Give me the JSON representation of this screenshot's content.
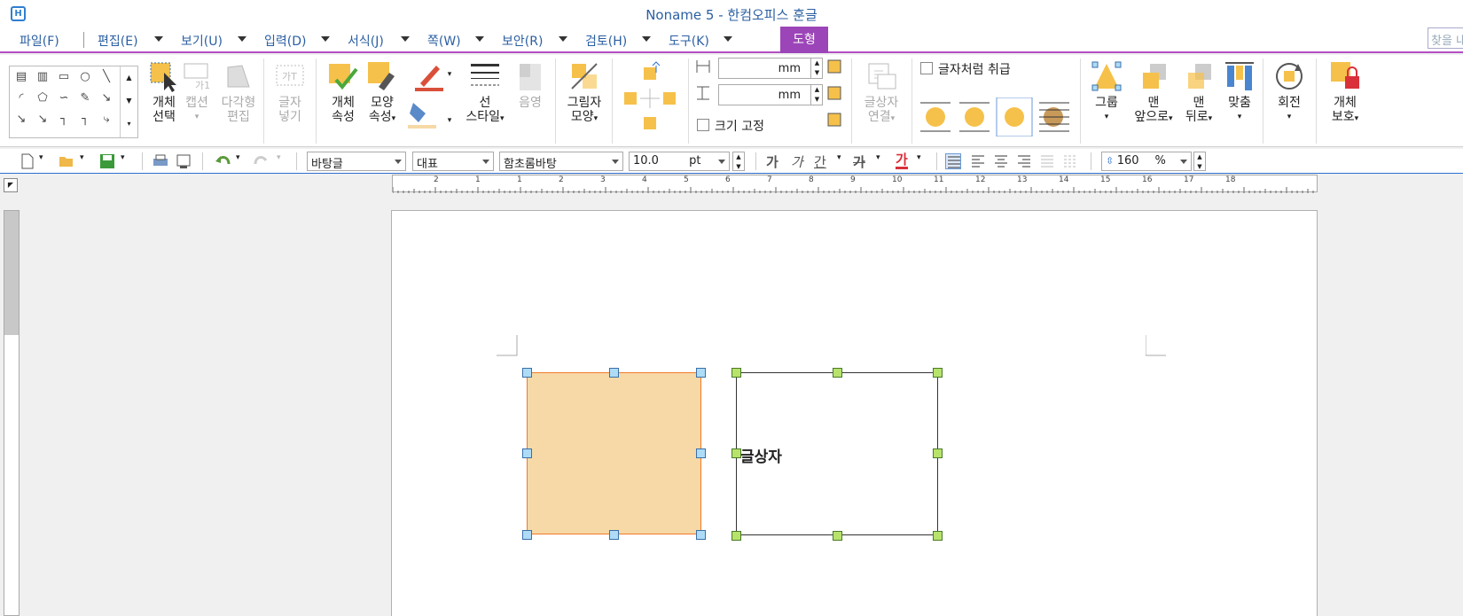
{
  "window": {
    "title": "Noname 5 - 한컴오피스 훈글"
  },
  "menu": {
    "items": [
      "파일(F)",
      "편집(E)",
      "보기(U)",
      "입력(D)",
      "서식(J)",
      "쪽(W)",
      "보안(R)",
      "검토(H)",
      "도구(K)"
    ],
    "active": "도형",
    "find_placeholder": "찾을 내"
  },
  "ribbon": {
    "select_object": {
      "line1": "개체",
      "line2": "선택"
    },
    "caption": {
      "line1": "캡션"
    },
    "polygon_edit": {
      "line1": "다각형",
      "line2": "편집"
    },
    "text_insert": {
      "line1": "글자",
      "line2": "넣기"
    },
    "object_props": {
      "line1": "개체",
      "line2": "속성"
    },
    "shape_props": {
      "line1": "모양",
      "line2": "속성"
    },
    "line_style": {
      "line1": "선",
      "line2": "스타일"
    },
    "shadow": {
      "line1": "음영"
    },
    "picture_shape": {
      "line1": "그림자",
      "line2": "모양"
    },
    "width_value": "mm",
    "height_value": "mm",
    "size_fixed": "크기 고정",
    "textbox_link": {
      "line1": "글상자",
      "line2": "연결"
    },
    "treat_as_char": "글자처럼 취급",
    "group": {
      "line1": "그룹"
    },
    "bring_front": {
      "line1": "맨",
      "line2": "앞으로"
    },
    "send_back": {
      "line1": "맨",
      "line2": "뒤로"
    },
    "align": {
      "line1": "맞춤"
    },
    "rotate": {
      "line1": "회전"
    },
    "protect": {
      "line1": "개체",
      "line2": "보호"
    }
  },
  "toolbar": {
    "style": "바탕글",
    "lang": "대표",
    "font": "함초롬바탕",
    "size": "10.0",
    "size_unit": "pt",
    "zoom": "160",
    "zoom_unit": "%",
    "bold": "가",
    "italic": "가",
    "underline": "간",
    "strike": "가",
    "color": "가"
  },
  "ruler": {
    "h_ticks": [
      "2",
      "1",
      "1",
      "2",
      "3",
      "4",
      "5",
      "6",
      "7",
      "8",
      "9",
      "10",
      "11",
      "12",
      "13",
      "14",
      "15",
      "16",
      "17",
      "18"
    ]
  },
  "document": {
    "textbox_text": "글상자"
  },
  "colors": {
    "accent": "#9c45b8",
    "shape_fill": "#f6d9a6",
    "shape_border": "#f07a2a",
    "menu_text": "#2b5fa2"
  }
}
